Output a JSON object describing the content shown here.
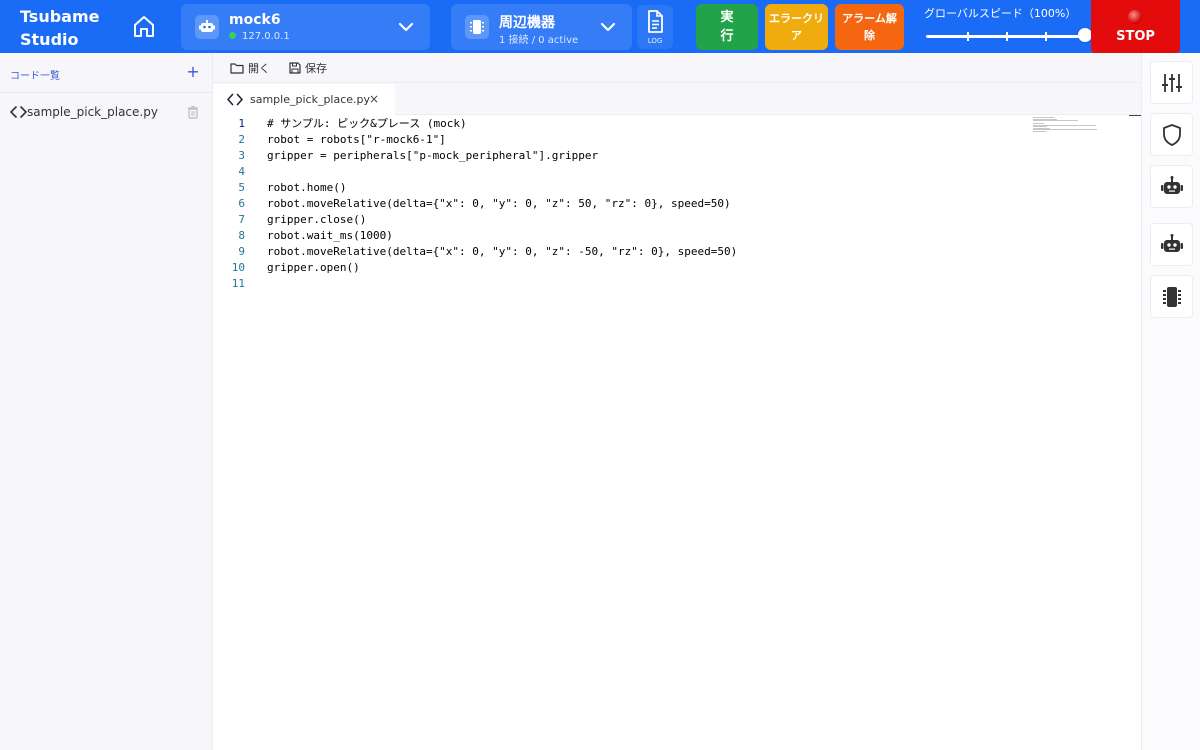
{
  "app": {
    "name_line1": "Tsubame",
    "name_line2": "Studio"
  },
  "robot_selector": {
    "name": "mock6",
    "address": "127.0.0.1",
    "status_color": "#34d058"
  },
  "peripheral_selector": {
    "name": "周辺機器",
    "status": "1 接続 / 0 active"
  },
  "log_button": {
    "label": "LOG"
  },
  "actions": {
    "run_line1": "実",
    "run_line2": "行",
    "error_clear_line1": "エラークリ",
    "error_clear_line2": "ア",
    "alarm_clear_line1": "アラーム解",
    "alarm_clear_line2": "除"
  },
  "speed": {
    "label": "グローバルスピード（100%）",
    "value_percent": 100
  },
  "stop": {
    "label": "STOP"
  },
  "sidebar": {
    "title": "コード一覧",
    "add_label": "+",
    "files": [
      {
        "name": "sample_pick_place.py"
      }
    ]
  },
  "toolbar": {
    "open_label": "開く",
    "save_label": "保存"
  },
  "tabs": [
    {
      "label": "sample_pick_place.py",
      "close_label": "×"
    }
  ],
  "editor": {
    "active_line": 1,
    "line_numbers": [
      "1",
      "2",
      "3",
      "4",
      "5",
      "6",
      "7",
      "8",
      "9",
      "10",
      "11"
    ],
    "lines": [
      "# サンプル: ピック&プレース (mock)",
      "robot = robots[\"r-mock6-1\"]",
      "gripper = peripherals[\"p-mock_peripheral\"].gripper",
      "",
      "robot.home()",
      "robot.moveRelative(delta={\"x\": 0, \"y\": 0, \"z\": 50, \"rz\": 0}, speed=50)",
      "gripper.close()",
      "robot.wait_ms(1000)",
      "robot.moveRelative(delta={\"x\": 0, \"y\": 0, \"z\": -50, \"rz\": 0}, speed=50)",
      "gripper.open()",
      ""
    ]
  },
  "right_rail": {
    "buttons": [
      {
        "icon": "sliders-icon"
      },
      {
        "icon": "shield-icon"
      },
      {
        "icon": "robot-icon"
      },
      {
        "icon": "robot-icon"
      },
      {
        "icon": "chip-icon"
      }
    ]
  },
  "colors": {
    "header": "#1a6cf6",
    "run": "#22a34a",
    "error_clear": "#f0ac0e",
    "alarm_clear": "#f4660f",
    "stop": "#e30b0b",
    "accent": "#3b5bcc"
  }
}
